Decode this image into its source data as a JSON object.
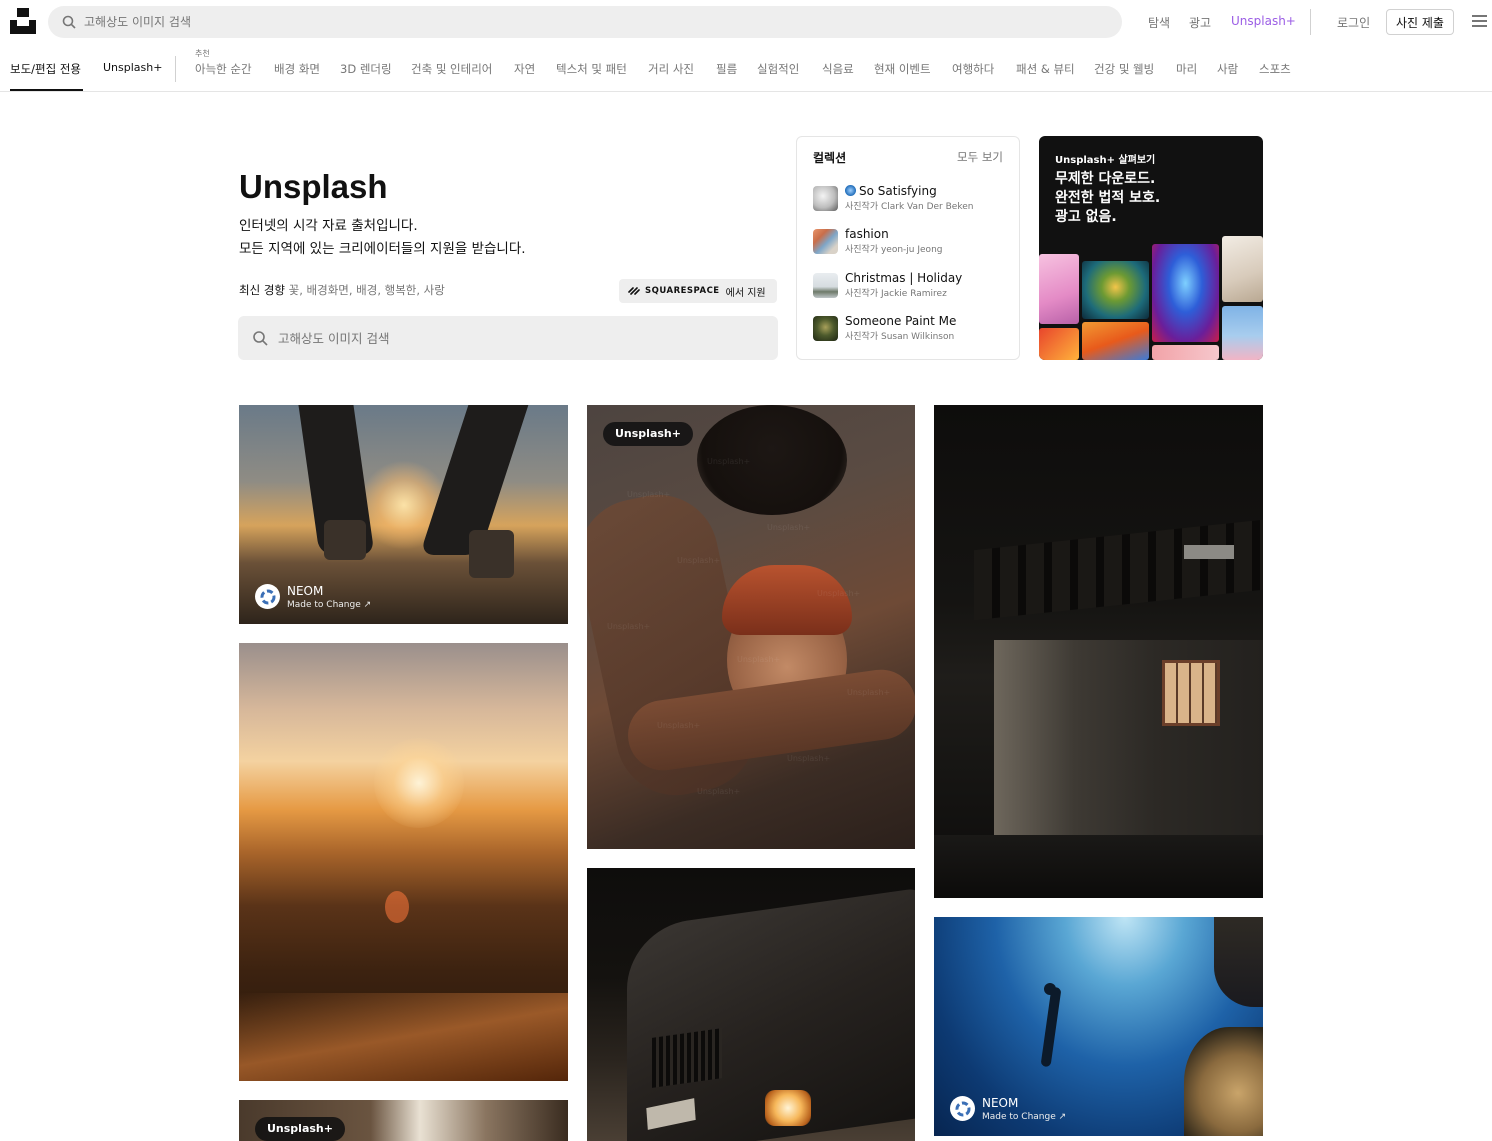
{
  "header": {
    "search_placeholder": "고해상도 이미지 검색",
    "nav": {
      "explore": "탐색",
      "advertise": "광고",
      "unsplash_plus": "Unsplash+",
      "login": "로그인",
      "submit_photo": "사진 제출"
    }
  },
  "topics": {
    "small_label": "추천",
    "editorial": "보도/편집 전용",
    "plus": "Unsplash+",
    "items": [
      "아늑한 순간",
      "배경 화면",
      "3D 렌더링",
      "건축 및 인테리어",
      "자연",
      "텍스처 및 패턴",
      "거리 사진",
      "필름",
      "실험적인",
      "식음료",
      "현재 이벤트",
      "여행하다",
      "패션 & 뷰티",
      "건강 및 웰빙",
      "마리",
      "사람",
      "스포츠"
    ]
  },
  "hero": {
    "title": "Unsplash",
    "desc_line1": "인터넷의 시각 자료 출처입니다.",
    "desc_line2": "모든 지역에 있는 크리에이터들의 지원을 받습니다.",
    "trending_label": "최신 경향",
    "trending_items": "꽃, 배경화면, 배경, 행복한, 사랑",
    "sponsor_brand": "SQUARESPACE",
    "sponsor_suffix": "에서 지원",
    "search_placeholder": "고해상도 이미지 검색"
  },
  "collections": {
    "heading": "컬렉션",
    "see_all": "모두 보기",
    "items": [
      {
        "name": "So Satisfying",
        "by": "사진작가 Clark Van Der Beken"
      },
      {
        "name": "fashion",
        "by": "사진작가 yeon-ju Jeong"
      },
      {
        "name": "Christmas | Holiday",
        "by": "사진작가 Jackie Ramirez"
      },
      {
        "name": "Someone Paint Me",
        "by": "사진작가 Susan Wilkinson"
      }
    ]
  },
  "promo": {
    "kicker": "Unsplash+ 살펴보기",
    "line1": "무제한 다운로드.",
    "line2": "완전한 법적 보호.",
    "line3": "광고 없음."
  },
  "photos": {
    "plus_badge": "Unsplash+",
    "sponsor_name": "NEOM",
    "sponsor_sub": "Made to Change ↗",
    "watermark": "Unsplash+"
  }
}
